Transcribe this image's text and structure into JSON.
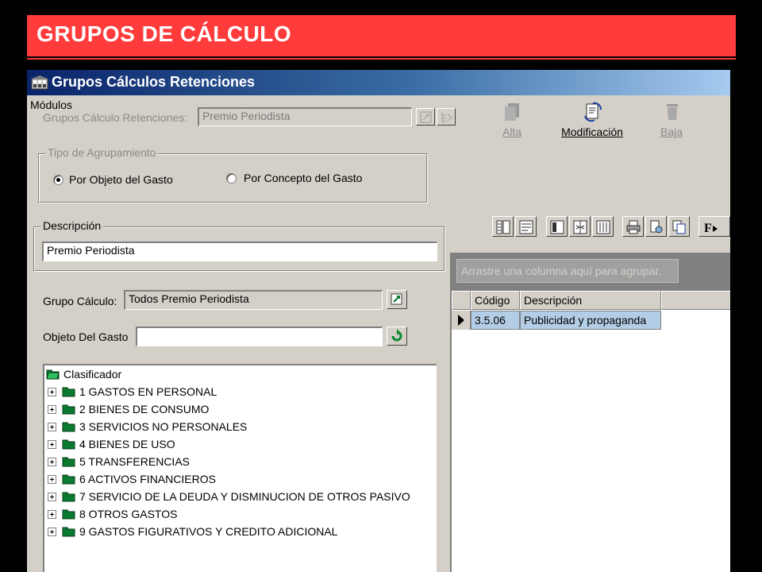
{
  "slide": {
    "title": "GRUPOS DE CÁLCULO"
  },
  "window": {
    "title": "Grupos Cálculos Retenciones"
  },
  "menu": {
    "modulos": "Módulos"
  },
  "form": {
    "grupos_label": "Grupos Cálculo Retenciones:",
    "grupos_value": "Premio Periodista",
    "tipo_group_title": "Tipo de Agrupamiento",
    "radio_objeto": "Por Objeto del Gasto",
    "radio_concepto": "Por Concepto del Gasto",
    "descripcion_title": "Descripción",
    "descripcion_value": "Premio Periodista",
    "grupo_calculo_label": "Grupo Cálculo:",
    "grupo_calculo_value": "Todos Premio Periodista",
    "objeto_label": "Objeto Del Gasto",
    "objeto_value": ""
  },
  "actions": {
    "alta": "Alta",
    "modificacion": "Modificación",
    "baja": "Baja"
  },
  "grid": {
    "group_hint": "Arrastre una columna aquí para agrupar.",
    "columns": [
      "Código",
      "Descripción"
    ],
    "rows": [
      {
        "codigo": "3.5.06",
        "descripcion": "Publicidad y propaganda"
      }
    ]
  },
  "tree": {
    "root": "Clasificador",
    "items": [
      "1 GASTOS EN PERSONAL",
      "2 BIENES DE CONSUMO",
      "3 SERVICIOS NO PERSONALES",
      "4 BIENES DE USO",
      "5 TRANSFERENCIAS",
      "6 ACTIVOS FINANCIEROS",
      "7 SERVICIO DE LA DEUDA Y DISMINUCION DE OTROS PASIVO",
      "8 OTROS GASTOS",
      "9 GASTOS FIGURATIVOS Y CREDITO ADICIONAL"
    ]
  },
  "colors": {
    "slide_accent": "#ff3b3b",
    "window_face": "#d4d0c8",
    "titlebar": "#0a246a",
    "selection": "#b4cde6",
    "folder": "#0a7a30"
  },
  "icons": [
    "window-app-icon",
    "ficha-icon",
    "tree-icon",
    "alta-icon",
    "modificacion-icon",
    "baja-icon",
    "toolbar-icons",
    "folder-icon",
    "refresh-icon",
    "row-pointer-icon"
  ]
}
